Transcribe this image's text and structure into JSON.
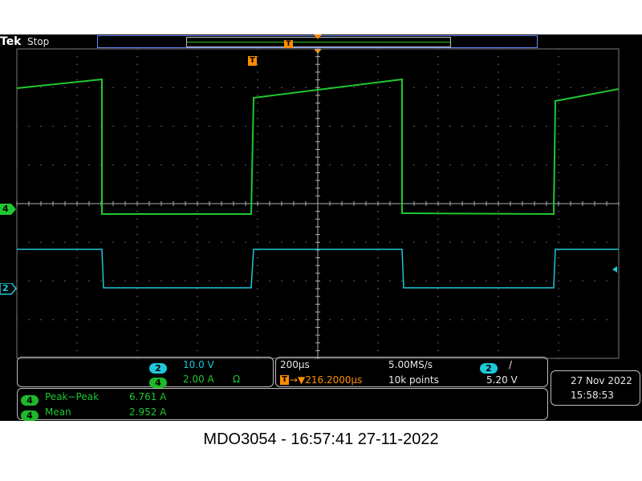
{
  "header": {
    "brand": "Tek",
    "status": "Stop",
    "trigger_marker": "T"
  },
  "channels": {
    "ch4_marker": "4",
    "ch2_marker": "2"
  },
  "scale_panel": {
    "ch2": {
      "badge": "2",
      "scale": "10.0 V"
    },
    "ch4": {
      "badge": "4",
      "scale": "2.00 A",
      "impedance_symbol": "Ω"
    }
  },
  "timebase_panel": {
    "horizontal_scale": "200µs",
    "sample_rate": "5.00MS/s",
    "trigger_source_badge": "2",
    "trigger_slope_symbol": "/",
    "trigger_position_icon": "T",
    "trigger_delay": "→▼216.2000µs",
    "record_length": "10k points",
    "trigger_level": "5.20 V"
  },
  "measurements": [
    {
      "badge": "4",
      "label": "Peak−Peak",
      "value": "6.761 A"
    },
    {
      "badge": "4",
      "label": "Mean",
      "value": "2.952 A"
    }
  ],
  "datetime_panel": {
    "date": "27 Nov 2022",
    "time": "15:58:53"
  },
  "caption": "MDO3054 - 16:57:41   27-11-2022",
  "colors": {
    "ch4": "#1fc82f",
    "ch2": "#1ec8d8",
    "trigger": "#ff8c00",
    "graticule": "#8a8a8a"
  }
}
